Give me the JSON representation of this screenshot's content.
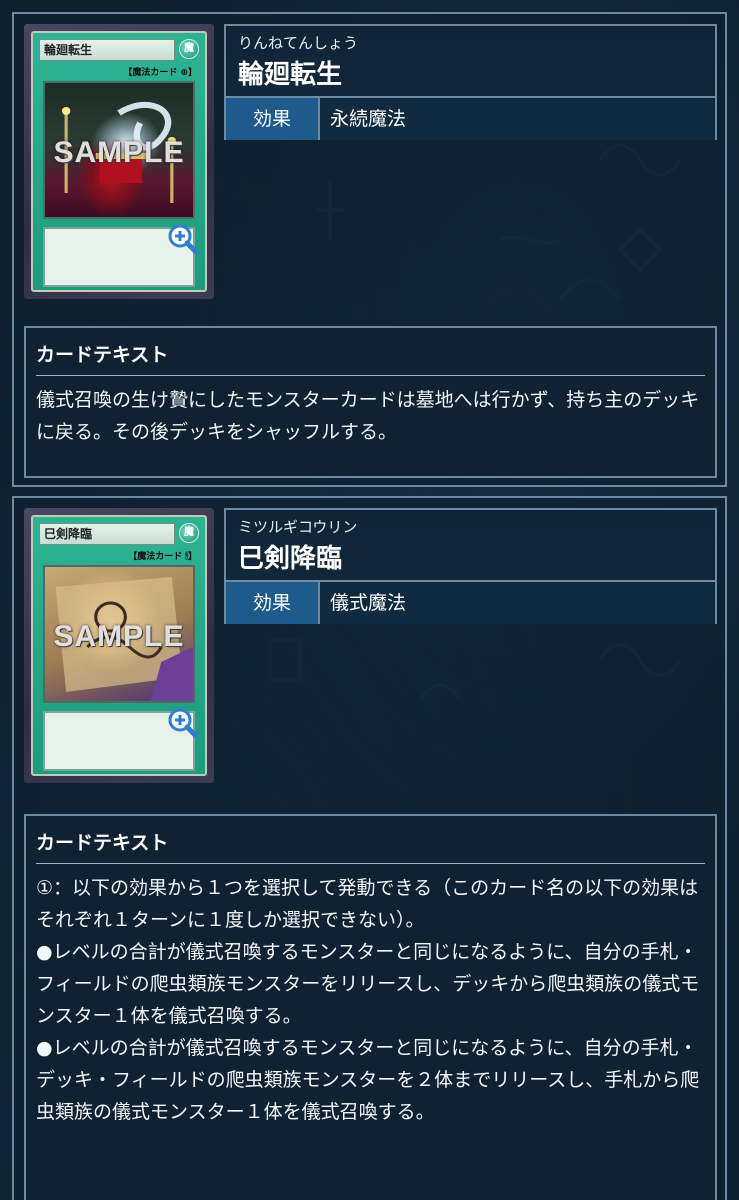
{
  "cards": [
    {
      "card_name_small": "輪廻転生",
      "attr_glyph": "魔",
      "card_type_label": "【魔法カード ⊕】",
      "sample_watermark": "SAMPLE",
      "reading": "りんねてんしょう",
      "title": "輪廻転生",
      "effect_key": "効果",
      "effect_value": "永続魔法",
      "text_heading": "カードテキスト",
      "text": "儀式召喚の生け贄にしたモンスターカードは墓地へは行かず、持ち主のデッキに戻る。その後デッキをシャッフルする。",
      "accent": "#1e5b8c"
    },
    {
      "card_name_small": "巳剣降臨",
      "attr_glyph": "魔",
      "card_type_label": "【魔法カード 🕯】",
      "sample_watermark": "SAMPLE",
      "reading": "ミツルギコウリン",
      "title": "巳剣降臨",
      "effect_key": "効果",
      "effect_value": "儀式魔法",
      "text_heading": "カードテキスト",
      "text": "①：以下の効果から１つを選択して発動できる（このカード名の以下の効果はそれぞれ１ターンに１度しか選択できない）。\n●レベルの合計が儀式召喚するモンスターと同じになるように、自分の手札・フィールドの爬虫類族モンスターをリリースし、デッキから爬虫類族の儀式モンスター１体を儀式召喚する。\n●レベルの合計が儀式召喚するモンスターと同じになるように、自分の手札・デッキ・フィールドの爬虫類族モンスターを２体までリリースし、手札から爬虫類族の儀式モンスター１体を儀式召喚する。",
      "accent": "#1e5b8c"
    }
  ],
  "icons": {
    "zoom": "zoom-in-magnifier-icon"
  },
  "colors": {
    "background": "#0e1f2e",
    "border": "#6d8aa2",
    "key_cell": "#1e5b8c",
    "spell_card_green": "#1c9b7d"
  }
}
